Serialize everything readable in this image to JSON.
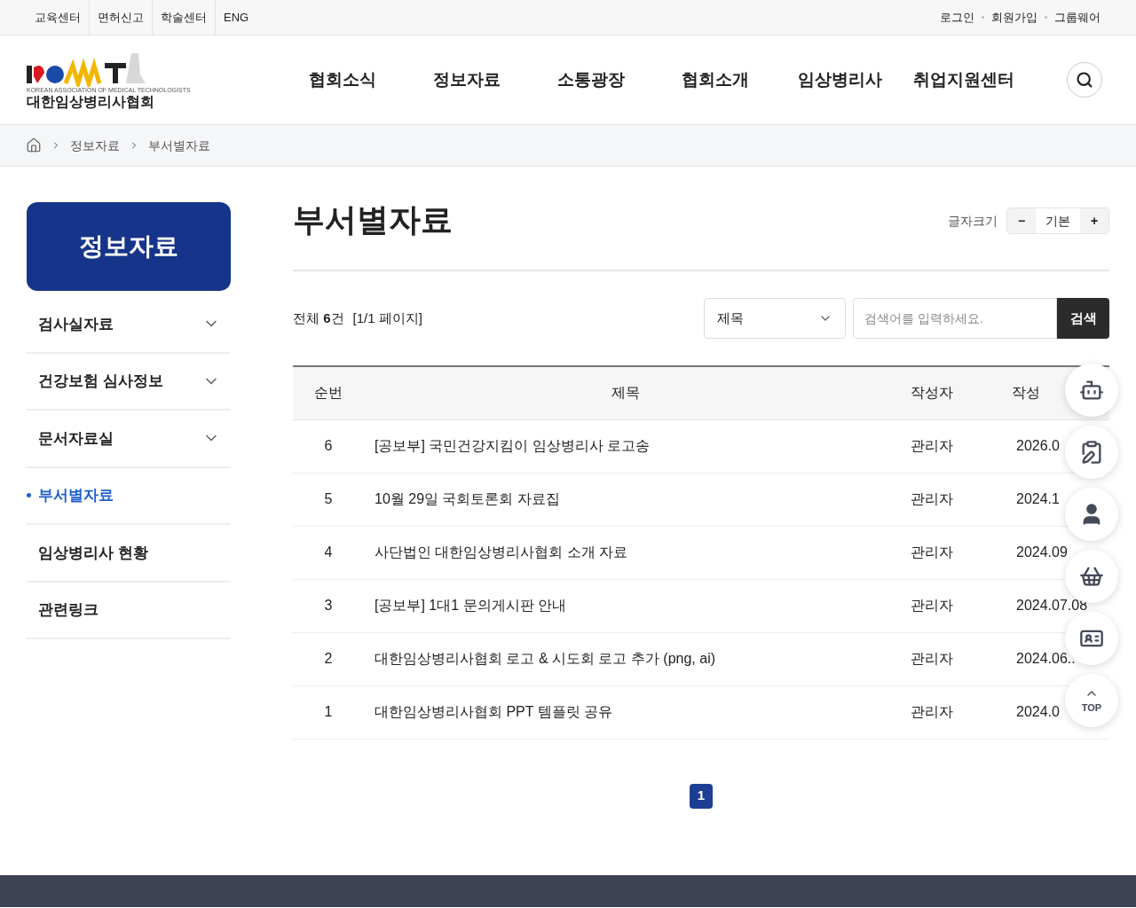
{
  "top_links": [
    "교육센터",
    "면허신고",
    "학술센터",
    "ENG"
  ],
  "account_links": [
    "로그인",
    "회원가입",
    "그룹웨어"
  ],
  "logo": {
    "tagline": "KOREAN ASSOCIATION OF MEDICAL TECHNOLOGISTS",
    "name": "대한임상병리사협회"
  },
  "nav": [
    "협회소식",
    "정보자료",
    "소통광장",
    "협회소개",
    "임상병리사",
    "취업지원센터"
  ],
  "breadcrumb": [
    "정보자료",
    "부서별자료"
  ],
  "sidebar": {
    "title": "정보자료",
    "items": [
      {
        "label": "검사실자료",
        "selected": false,
        "expandable": true
      },
      {
        "label": "건강보험 심사정보",
        "selected": false,
        "expandable": true
      },
      {
        "label": "문서자료실",
        "selected": false,
        "expandable": true
      },
      {
        "label": "부서별자료",
        "selected": true,
        "expandable": false
      },
      {
        "label": "임상병리사 현황",
        "selected": false,
        "expandable": false
      },
      {
        "label": "관련링크",
        "selected": false,
        "expandable": false
      }
    ]
  },
  "page_title": "부서별자료",
  "font_size": {
    "label": "글자크기",
    "decrease": "−",
    "current": "기본",
    "increase": "+"
  },
  "summary": {
    "total_prefix": "전체 ",
    "total_count": "6",
    "total_suffix": "건",
    "pages": "[1/1 페이지]"
  },
  "search": {
    "field": "제목",
    "placeholder": "검색어를 입력하세요.",
    "button": "검색"
  },
  "table": {
    "columns": [
      "순번",
      "제목",
      "작성자",
      "작성"
    ],
    "rows": [
      {
        "no": "6",
        "title": "[공보부] 국민건강지킴이 임상병리사 로고송",
        "author": "관리자",
        "date": "2026.0"
      },
      {
        "no": "5",
        "title": "10월 29일 국회토론회 자료집",
        "author": "관리자",
        "date": "2024.1"
      },
      {
        "no": "4",
        "title": "사단법인 대한임상병리사협회 소개 자료",
        "author": "관리자",
        "date": "2024.09"
      },
      {
        "no": "3",
        "title": "[공보부] 1대1 문의게시판 안내",
        "author": "관리자",
        "date": "2024.07.08"
      },
      {
        "no": "2",
        "title": "대한임상병리사협회 로고 & 시도회 로고 추가 (png, ai)",
        "author": "관리자",
        "date": "2024.06.."
      },
      {
        "no": "1",
        "title": "대한임상병리사협회 PPT 템플릿 공유",
        "author": "관리자",
        "date": "2024.0"
      }
    ]
  },
  "pagination": [
    {
      "label": "1",
      "selected": true
    }
  ],
  "quick_menu": [
    {
      "kind": "chatbot"
    },
    {
      "kind": "form"
    },
    {
      "kind": "person"
    },
    {
      "kind": "basket"
    },
    {
      "kind": "certificate"
    },
    {
      "kind": "top",
      "label": "TOP"
    }
  ]
}
